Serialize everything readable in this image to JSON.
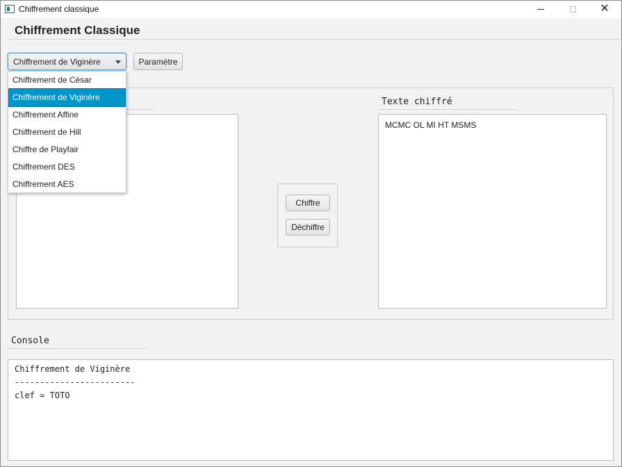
{
  "window": {
    "title": "Chiffrement classique"
  },
  "app": {
    "heading": "Chiffrement Classique"
  },
  "toolbar": {
    "selected_cipher": "Chiffrement de Viginère",
    "param_label": "Paramètre"
  },
  "dropdown": {
    "items": [
      "Chiffrement de César",
      "Chiffrement de Viginère",
      "Chiffrement Affine",
      "Chiffrement de Hill",
      "Chiffre de Playfair",
      "Chiffrement DES",
      "Chiffrement AES"
    ]
  },
  "cipher_panel": {
    "label": "Texte chiffré",
    "text": "MCMC OL MI HT MSMS"
  },
  "actions": {
    "encrypt_label": "Chiffre",
    "decrypt_label": "Déchiffre"
  },
  "console": {
    "label": "Console",
    "lines": [
      "Chiffrement de Viginère",
      "------------------------",
      "clef = TOTO"
    ]
  }
}
